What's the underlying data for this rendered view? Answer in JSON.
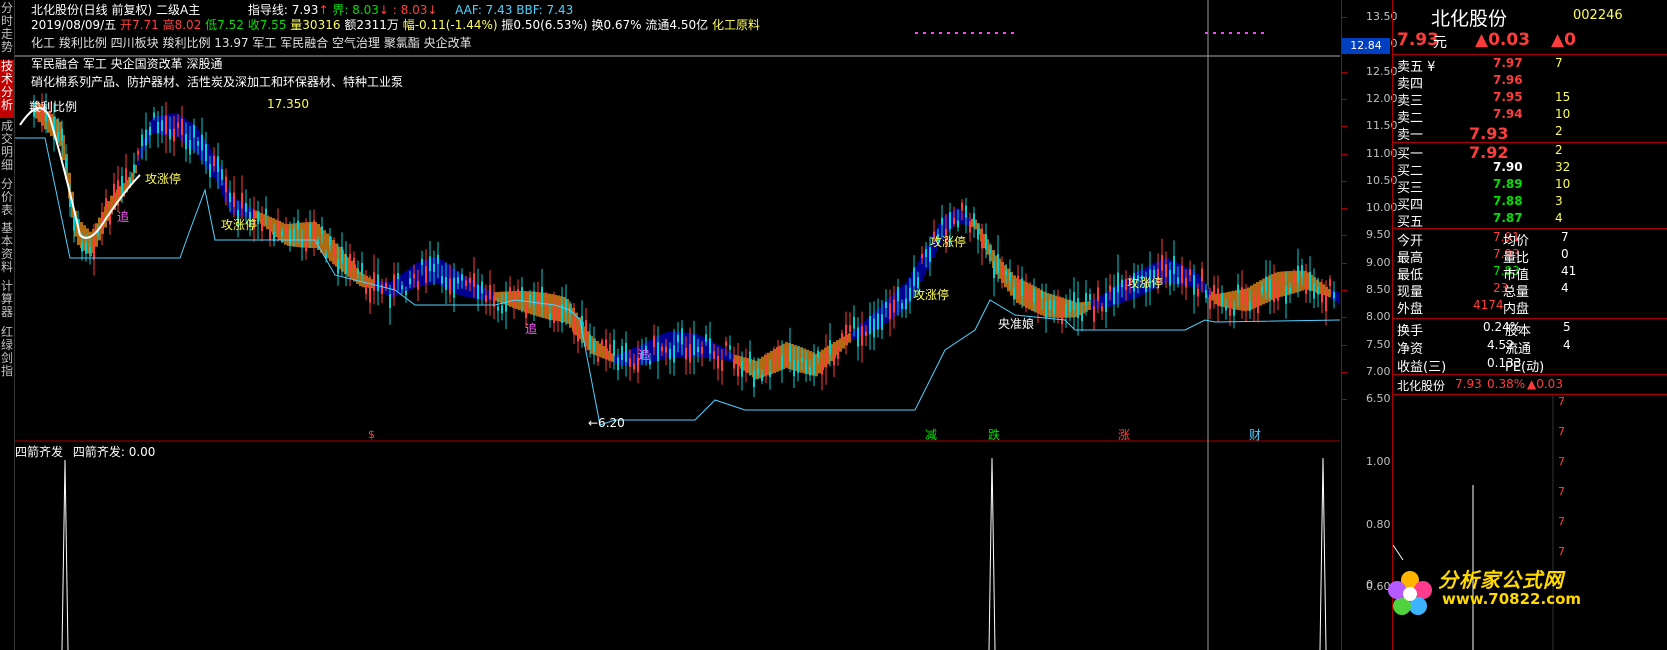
{
  "left_tabs": [
    {
      "label": "分时走势",
      "active": false
    },
    {
      "label": "技术分析",
      "active": true
    },
    {
      "label": "成交明细",
      "active": false
    },
    {
      "label": "分价表",
      "active": false
    },
    {
      "label": "基本资料",
      "active": false
    },
    {
      "label": "计算器",
      "active": false
    },
    {
      "label": "红绿剑指",
      "active": false
    }
  ],
  "header": {
    "title": "北化股份(日线 前复权) 二级A主",
    "guide_label": "指导线: 7.93",
    "jie_label": "界: 8.03",
    "jie2_label": ": 8.03",
    "aaf_label": "AAF: 7.43",
    "bbf_label": "BBF: 7.43",
    "date": "2019/08/09/五",
    "open": "开7.71",
    "high": "高8.02",
    "low": "低7.52",
    "close": "收7.55",
    "volume": "量30316",
    "amount": "额2311万",
    "change": "幅-0.11(-1.44%)",
    "amplitude": "振0.50(6.53%)",
    "turnover": "换0.67%",
    "float": "流通4.50亿",
    "industry": "化工原料",
    "concept_line": "化工 羧利比例 四川板块 羧利比例 13.97 军工  军民融合  空气治理  聚氯酯  央企改革",
    "tags_line1": "军民融合 军工 央企国资改革 深股通",
    "tags_line2": "硝化棉系列产品、防护器材、活性炭及深加工和环保器材、特种工业泵",
    "ratio_label": "羧利比例",
    "ratio_value": "17.350"
  },
  "annotations": {
    "zhui1": "追",
    "zhui2": "追",
    "zhui3": "追",
    "gong1": "攻涨停",
    "gong2": "攻涨停",
    "gong3": "攻涨停",
    "gong4": "攻涨停",
    "gong5": "攻涨停",
    "yangzhun": "央准娘",
    "low_label": "←6.20",
    "sig_dollar": "$",
    "sig_jian": "减",
    "sig_die": "跌",
    "sig_zhang": "涨",
    "sig_cai": "财"
  },
  "price_axis": {
    "ticks": [
      "13.50",
      "13.00",
      "12.50",
      "12.00",
      "11.50",
      "11.00",
      "10.50",
      "10.00",
      "9.50",
      "9.00",
      "8.50",
      "8.00",
      "7.50",
      "7.00",
      "6.50"
    ],
    "tag": "12.84"
  },
  "sub_panel": {
    "title": "四箭齐发",
    "value_label": "四箭齐发: 0.00",
    "ticks": [
      "1.00",
      "0.80",
      "0.60",
      "0"
    ]
  },
  "quote": {
    "name": "北化股份",
    "code": "002246",
    "price": "7.93",
    "unit": "元",
    "change": "▲0.03",
    "change_pct": "▲0",
    "asks": [
      {
        "label": "卖五 ¥",
        "price": "7.97",
        "vol": "7"
      },
      {
        "label": "卖四",
        "price": "7.96",
        "vol": ""
      },
      {
        "label": "卖三",
        "price": "7.95",
        "vol": "15"
      },
      {
        "label": "卖二",
        "price": "7.94",
        "vol": "10"
      },
      {
        "label": "卖一",
        "price": "7.93",
        "vol": "2"
      }
    ],
    "bids": [
      {
        "label": "买一",
        "price": "7.92",
        "vol": "2"
      },
      {
        "label": "买二",
        "price": "7.90",
        "vol": "32"
      },
      {
        "label": "买三",
        "price": "7.89",
        "vol": "10"
      },
      {
        "label": "买四",
        "price": "7.88",
        "vol": "3"
      },
      {
        "label": "买五",
        "price": "7.87",
        "vol": "4"
      }
    ],
    "stats": [
      {
        "k1": "今开",
        "v1": "7.91",
        "k2": "均价",
        "v2": "7"
      },
      {
        "k1": "最高",
        "v1": "7.93",
        "k2": "量比",
        "v2": "0"
      },
      {
        "k1": "最低",
        "v1": "7.83",
        "k2": "市值",
        "v2": "41"
      },
      {
        "k1": "现量",
        "v1": "23",
        "k2": "总量",
        "v2": "4"
      },
      {
        "k1": "外盘",
        "v1": "4174",
        "k2": "内盘",
        "v2": ""
      }
    ],
    "stats2": [
      {
        "k1": "换手",
        "v1": "0.24%",
        "k2": "股本",
        "v2": "5"
      },
      {
        "k1": "净资",
        "v1": "4.52",
        "k2": "流通",
        "v2": "4"
      },
      {
        "k1": "收益(三)",
        "v1": "0.133",
        "k2": "PE(动)",
        "v2": ""
      }
    ],
    "mini": {
      "name": "北化股份",
      "price": "7.93",
      "pct": "0.38%",
      "chg": "▲0.03"
    }
  },
  "watermark": {
    "site": "分析家公式网",
    "url": "www.70822.com"
  },
  "colors": {
    "up": "#ff3c3c",
    "down": "#00e000",
    "blue_fill": "#000090",
    "orange_fill": "#b06a10",
    "accent": "#ffff54"
  }
}
